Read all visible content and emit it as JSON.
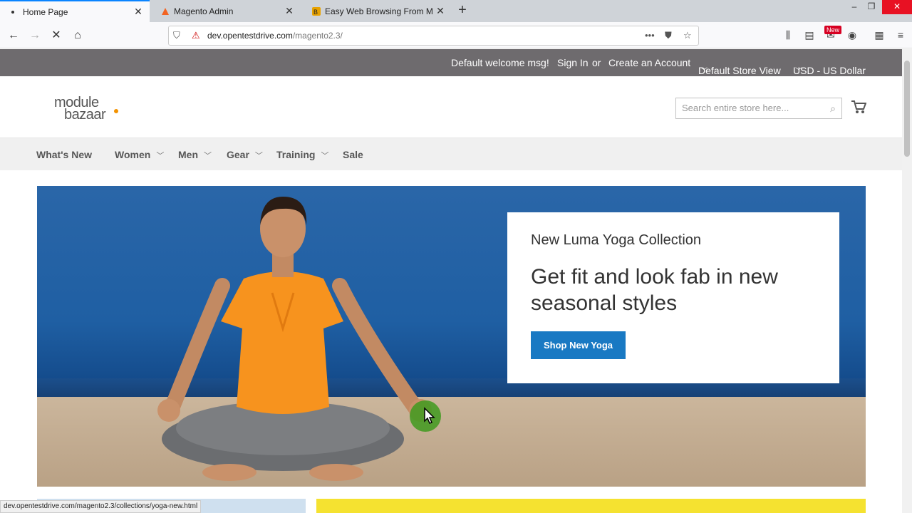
{
  "browser": {
    "tabs": [
      {
        "label": "Home Page",
        "active": true,
        "favicon": "dot-icon"
      },
      {
        "label": "Magento Admin",
        "active": false,
        "favicon": "magento-icon"
      },
      {
        "label": "Easy Web Browsing From Mul",
        "active": false,
        "favicon": "ub-icon"
      }
    ],
    "url_host": "dev.opentestdrive.com",
    "url_path": "/magento2.3/",
    "new_badge": "New",
    "status_url": "dev.opentestdrive.com/magento2.3/collections/yoga-new.html"
  },
  "header": {
    "welcome": "Default welcome msg!",
    "sign_in": "Sign In",
    "or": "or",
    "create_account": "Create an Account",
    "store_view": "Default Store View",
    "currency": "USD - US Dollar"
  },
  "logo": {
    "line1": "module",
    "line2": "bazaar"
  },
  "search": {
    "placeholder": "Search entire store here..."
  },
  "menu": {
    "items": [
      {
        "label": "What's New"
      },
      {
        "label": "Women"
      },
      {
        "label": "Men"
      },
      {
        "label": "Gear"
      },
      {
        "label": "Training"
      },
      {
        "label": "Sale"
      }
    ]
  },
  "hero": {
    "kicker": "New Luma Yoga Collection",
    "title": "Get fit and look fab in new seasonal styles",
    "button": "Shop New Yoga"
  },
  "colors": {
    "accent": "#1979c3",
    "topbar": "#6e6b6e",
    "logo_dot": "#f39200"
  }
}
